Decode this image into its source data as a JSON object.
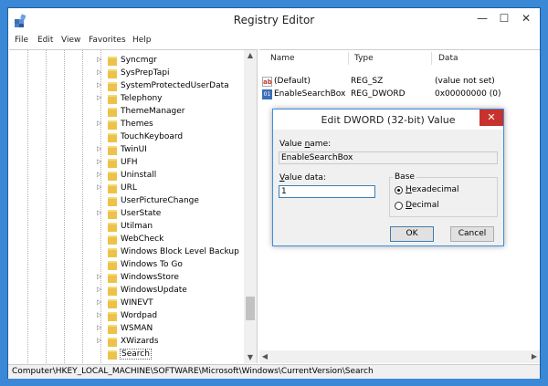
{
  "window": {
    "title": "Registry Editor",
    "minimize_glyph": "—",
    "maximize_glyph": "☐",
    "close_glyph": "✕"
  },
  "menu": [
    "File",
    "Edit",
    "View",
    "Favorites",
    "Help"
  ],
  "tree": {
    "items": [
      {
        "label": "Syncmgr",
        "expander": "▷"
      },
      {
        "label": "SysPrepTapi",
        "expander": "▷"
      },
      {
        "label": "SystemProtectedUserData",
        "expander": "▷"
      },
      {
        "label": "Telephony",
        "expander": "▷"
      },
      {
        "label": "ThemeManager",
        "expander": ""
      },
      {
        "label": "Themes",
        "expander": "▷"
      },
      {
        "label": "TouchKeyboard",
        "expander": ""
      },
      {
        "label": "TwinUI",
        "expander": "▷"
      },
      {
        "label": "UFH",
        "expander": "▷"
      },
      {
        "label": "Uninstall",
        "expander": "▷"
      },
      {
        "label": "URL",
        "expander": "▷"
      },
      {
        "label": "UserPictureChange",
        "expander": ""
      },
      {
        "label": "UserState",
        "expander": "▷"
      },
      {
        "label": "Utilman",
        "expander": ""
      },
      {
        "label": "WebCheck",
        "expander": ""
      },
      {
        "label": "Windows Block Level Backup",
        "expander": ""
      },
      {
        "label": "Windows To Go",
        "expander": ""
      },
      {
        "label": "WindowsStore",
        "expander": "▷"
      },
      {
        "label": "WindowsUpdate",
        "expander": "▷"
      },
      {
        "label": "WINEVT",
        "expander": "▷"
      },
      {
        "label": "Wordpad",
        "expander": "▷"
      },
      {
        "label": "WSMAN",
        "expander": "▷"
      },
      {
        "label": "XWizards",
        "expander": "▷"
      },
      {
        "label": "Search",
        "expander": ""
      }
    ]
  },
  "list": {
    "headers": {
      "name": "Name",
      "type": "Type",
      "data": "Data"
    },
    "rows": [
      {
        "icon": "ab",
        "name": "(Default)",
        "type": "REG_SZ",
        "data": "(value not set)"
      },
      {
        "icon": "01",
        "name": "EnableSearchBox",
        "type": "REG_DWORD",
        "data": "0x00000000 (0)"
      }
    ]
  },
  "status": "Computer\\HKEY_LOCAL_MACHINE\\SOFTWARE\\Microsoft\\Windows\\CurrentVersion\\Search",
  "dialog": {
    "title": "Edit DWORD (32-bit) Value",
    "close_glyph": "✕",
    "value_name_label_prefix": "Value ",
    "value_name_label_accel": "n",
    "value_name_label_suffix": "ame:",
    "value_name": "EnableSearchBox",
    "value_data_label_prefix": "",
    "value_data_label_accel": "V",
    "value_data_label_suffix": "alue data:",
    "value_data": "1",
    "base_label": "Base",
    "hex_accel": "H",
    "hex_rest": "exadecimal",
    "dec_accel": "D",
    "dec_rest": "ecimal",
    "ok_label": "OK",
    "cancel_label": "Cancel"
  },
  "colors": {
    "desktop": "#3a88d6",
    "close_red": "#c7322d",
    "folder": "#ecc24a"
  }
}
